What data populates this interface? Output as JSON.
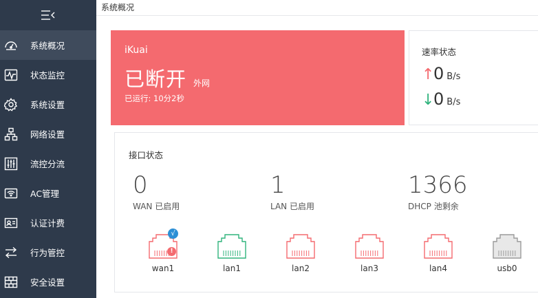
{
  "breadcrumb": "系统概况",
  "sidebar": {
    "items": [
      {
        "label": "系统概况",
        "icon": "dashboard-icon"
      },
      {
        "label": "状态监控",
        "icon": "pulse-monitor-icon"
      },
      {
        "label": "系统设置",
        "icon": "gear-icon"
      },
      {
        "label": "网络设置",
        "icon": "network-topology-icon"
      },
      {
        "label": "流控分流",
        "icon": "sliders-icon"
      },
      {
        "label": "AC管理",
        "icon": "wifi-icon"
      },
      {
        "label": "认证计费",
        "icon": "id-card-icon"
      },
      {
        "label": "行为管控",
        "icon": "swap-arrows-icon"
      },
      {
        "label": "安全设置",
        "icon": "firewall-icon"
      }
    ]
  },
  "status": {
    "brand": "iKuai",
    "state": "已断开",
    "sub": "外网",
    "uptime": "已运行: 10分2秒"
  },
  "rate": {
    "title": "速率状态",
    "up_arrow": "↑",
    "down_arrow": "↓",
    "up_value": "0",
    "down_value": "0",
    "unit": "B/s"
  },
  "interfaces": {
    "title": "接口状态",
    "stats": [
      {
        "value": "0",
        "caption": "WAN 已启用"
      },
      {
        "value": "1",
        "caption": "LAN 已启用"
      },
      {
        "value": "1366",
        "caption": "DHCP 池剩余"
      }
    ],
    "ports": [
      {
        "label": "wan1",
        "color": "#f46a6f"
      },
      {
        "label": "lan1",
        "color": "#2fb37c"
      },
      {
        "label": "lan2",
        "color": "#f46a6f"
      },
      {
        "label": "lan3",
        "color": "#f46a6f"
      },
      {
        "label": "lan4",
        "color": "#f46a6f"
      },
      {
        "label": "usb0",
        "color": "#9a9a9a"
      }
    ],
    "badge_ok": "√",
    "badge_warn": "!"
  },
  "colors": {
    "sidebar_bg": "#2e3a4b",
    "status_red": "#f46a6f",
    "ok_green": "#2fb37c",
    "badge_blue": "#2d8fd5"
  }
}
